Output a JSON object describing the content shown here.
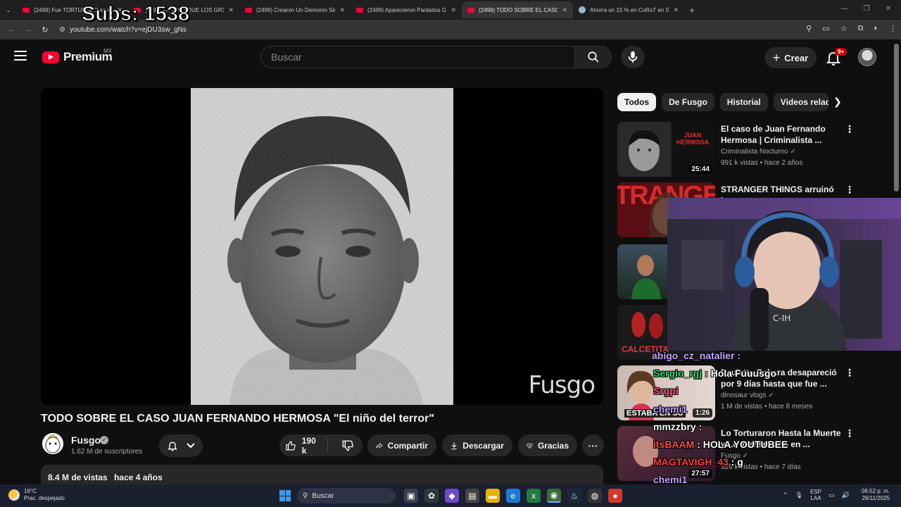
{
  "browser": {
    "tabs": [
      {
        "title": "(2499) Fue TORTURADO en un",
        "favicon": "youtube",
        "active": false
      },
      {
        "title": "(2499) PARECE QUE LOS GR1NG",
        "favicon": "youtube",
        "active": false
      },
      {
        "title": "(2499) Crearon Un Demonio Sin",
        "favicon": "youtube",
        "active": false
      },
      {
        "title": "(2499) Aparecieron Parásitos Gi",
        "favicon": "youtube",
        "active": false
      },
      {
        "title": "(2499) TODO SOBRE EL CASO J",
        "favicon": "youtube",
        "active": true
      },
      {
        "title": "Ahorra un 15 % en CoRoT en St",
        "favicon": "steam",
        "active": false
      }
    ],
    "url": "youtube.com/watch?v=ejDU3sw_gNs"
  },
  "stream_overlay": {
    "subs_label": "Subs: 1538",
    "chat": [
      {
        "user": "abigo_cz_natalier",
        "text": ""
      },
      {
        "user": "Sergio_rgj",
        "text": "Hola Fuuusgo"
      },
      {
        "user": "Srgpi",
        "text": ""
      },
      {
        "user": "chemi1",
        "text": ""
      },
      {
        "user": "mmzzbry",
        "text": ""
      },
      {
        "user": "itsBAAM",
        "text": "HOLA YOUTUBEE"
      },
      {
        "user": "MAGTAVIGH_43",
        "text": "g"
      },
      {
        "user": "chemi1",
        "text": ""
      }
    ]
  },
  "youtube": {
    "logo_text": "Premium",
    "country": "MX",
    "search_placeholder": "Buscar",
    "create_label": "Crear",
    "notif_count": "9+",
    "video": {
      "watermark": "Fusgo",
      "title": "TODO SOBRE EL CASO JUAN FERNANDO HERMOSA \"El niño del terror\"",
      "channel": "Fusgo",
      "subscribers": "1.62 M de suscriptores",
      "likes": "190 k",
      "share_label": "Compartir",
      "download_label": "Descargar",
      "thanks_label": "Gracias",
      "views": "8.4 M de vistas",
      "age": "hace 4 años"
    },
    "chips": [
      "Todos",
      "De Fusgo",
      "Historial",
      "Videos relacionados"
    ],
    "recommendations": [
      {
        "title": "El caso de Juan Fernando Hermosa | Criminalista ...",
        "channel": "Criminalista Nocturno",
        "verified": true,
        "meta": "991 k vistas • hace 2 años",
        "duration": "25:44",
        "thumb_text": "JUAN HERMOSA"
      },
      {
        "title": "STRANGER THINGS arruinó la",
        "channel": "",
        "verified": false,
        "meta": "",
        "duration": "",
        "thumb_text": "TRANGE"
      },
      {
        "title": "",
        "channel": "",
        "verified": false,
        "meta": "",
        "duration": "",
        "thumb_text": ""
      },
      {
        "title": "",
        "channel": "",
        "verified": false,
        "meta": "",
        "duration": "",
        "thumb_text": "CALCETITA"
      },
      {
        "title": "Paulette Gebara desapareció por 9 días hasta que fue ...",
        "channel": "dinosaur vlogs",
        "verified": true,
        "meta": "1 M de vistas • hace 8 meses",
        "duration": "1:26",
        "thumb_text": "ESTABA EN SU"
      },
      {
        "title": "Lo Torturaron Hasta la Muerte y Lo Transmitido en ...",
        "channel": "Fusgo",
        "verified": true,
        "meta": "329 k vistas • hace 7 días",
        "duration": "27:57",
        "thumb_text": ""
      }
    ]
  },
  "taskbar": {
    "temperature": "16°C",
    "weather": "Prac. despejado",
    "search_label": "Buscar",
    "lang_top": "ESP",
    "lang_bottom": "LAA",
    "time": "06:52 p. m.",
    "date": "26/11/2025"
  },
  "colors": {
    "youtube_red": "#ff0033",
    "page_bg": "#0f0f0f",
    "chip_bg": "#272727"
  }
}
